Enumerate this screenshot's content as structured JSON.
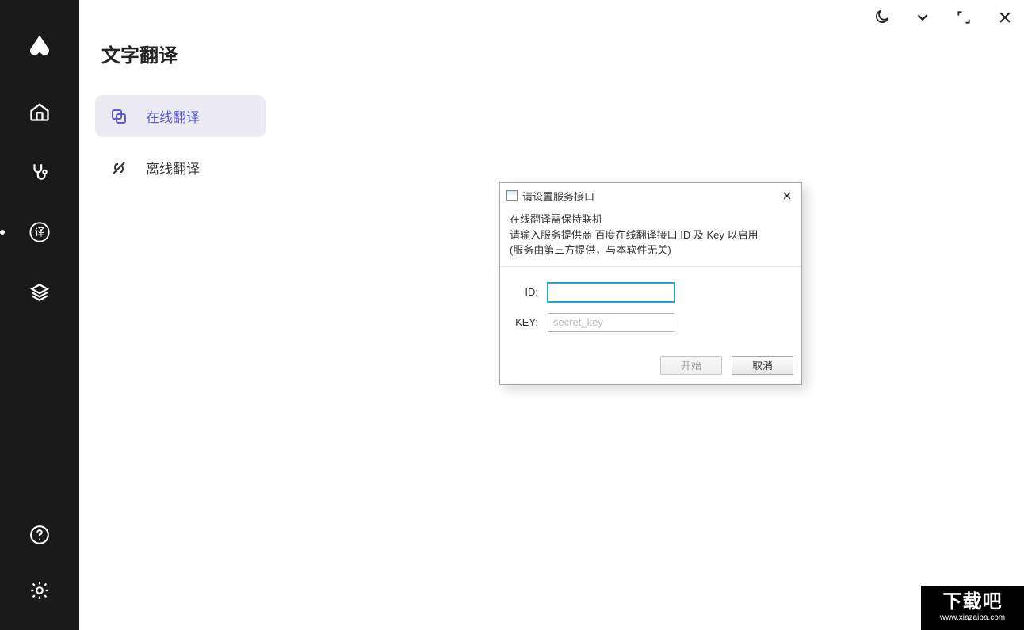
{
  "sidebar": {
    "title": "文字翻译",
    "items": [
      {
        "label": "在线翻译"
      },
      {
        "label": "离线翻译"
      }
    ]
  },
  "rail_icons": {
    "logo": "logo-icon",
    "home": "home-icon",
    "diagnose": "stethoscope-icon",
    "translate": "translate-icon",
    "layers": "layers-icon",
    "help": "help-icon",
    "settings": "gear-icon"
  },
  "titlebar_icons": {
    "theme": "moon-icon",
    "down": "chevron-down-icon",
    "expand": "expand-icon",
    "close": "close-icon"
  },
  "dialog": {
    "title": "请设置服务接口",
    "info_line1": "在线翻译需保持联机",
    "info_line2": "请输入服务提供商 百度在线翻译接口 ID 及 Key 以启用",
    "info_line3": "(服务由第三方提供，与本软件无关)",
    "id_label": "ID:",
    "id_value": "",
    "key_label": "KEY:",
    "key_value": "",
    "key_placeholder": "secret_key",
    "start_label": "开始",
    "cancel_label": "取消"
  },
  "watermark": {
    "big": "下载吧",
    "small": "www.xiazaiba.com"
  }
}
